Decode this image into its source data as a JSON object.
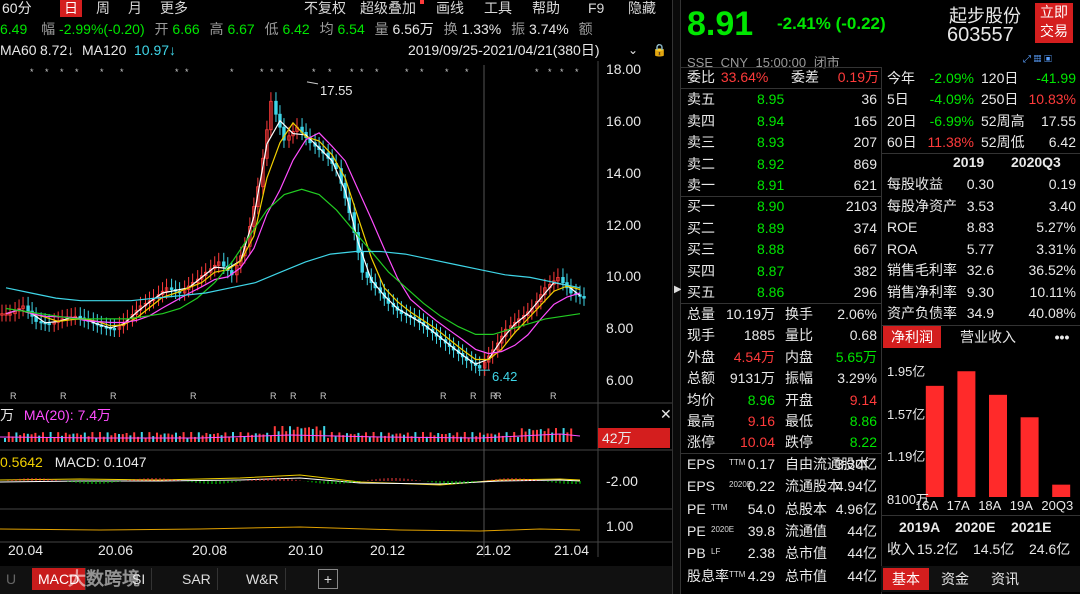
{
  "toolbar": {
    "period": "60分",
    "day": "日",
    "week": "周",
    "month": "月",
    "more": "更多",
    "fq": "不复权",
    "overlay": "超级叠加",
    "draw": "画线",
    "tools": "工具",
    "help": "帮助",
    "f9": "F9",
    "hide": "隐藏"
  },
  "quote_strip": {
    "price": "6.49",
    "change_label": "幅",
    "change": "-2.99%(-0.20)",
    "open_label": "开",
    "open": "6.66",
    "high_label": "高",
    "high": "6.67",
    "low_label": "低",
    "low": "6.42",
    "avg_label": "均",
    "avg": "6.54",
    "vol_label": "量",
    "vol": "6.56万",
    "turnover_label": "换",
    "turnover": "1.33%",
    "amp_label": "振",
    "amp": "3.74%",
    "amount_label": "额"
  },
  "ma_legend": {
    "ma60_label": "MA60",
    "ma60": "8.72↓",
    "ma120_label": "MA120",
    "ma120": "10.97↓",
    "range": "2019/09/25-2021/04/21(380日)"
  },
  "chart_data": {
    "type": "line",
    "title": "",
    "y_ticks": [
      "18.00",
      "16.00",
      "14.00",
      "12.00",
      "10.00",
      "8.00",
      "6.00"
    ],
    "ylim": [
      5.5,
      18.2
    ],
    "x_ticks": [
      "20.04",
      "20.06",
      "20.08",
      "20.10",
      "20.12",
      "21.02",
      "21.04"
    ],
    "high_label": "17.55",
    "low_label": "6.42",
    "price": [
      8.6,
      8.9,
      8.3,
      8.2,
      8.4,
      8.5,
      8.3,
      8.1,
      8.0,
      8.4,
      8.9,
      9.2,
      9.6,
      9.4,
      9.8,
      10.2,
      10.6,
      10.1,
      11.2,
      13.5,
      16.8,
      15.3,
      15.8,
      15.2,
      14.8,
      14.2,
      12.5,
      10.2,
      9.6,
      9.0,
      8.6,
      8.4,
      8.0,
      7.6,
      7.2,
      6.8,
      6.5,
      7.2,
      8.0,
      8.4,
      8.8,
      9.6,
      10.0,
      9.4,
      9.2
    ],
    "ma60": [
      8.8,
      8.7,
      8.6,
      8.5,
      8.4,
      8.4,
      8.4,
      8.4,
      8.5,
      8.6,
      8.8,
      9.2,
      9.8,
      10.6,
      11.6,
      12.6,
      13.2,
      13.4,
      13.2,
      12.6,
      11.8,
      11.0,
      10.2,
      9.6,
      9.0,
      8.5,
      8.1,
      7.8,
      7.8,
      8.0,
      8.2,
      8.4,
      8.5,
      8.6
    ],
    "ma120": [
      9.6,
      9.4,
      9.2,
      9.1,
      9.1,
      9.1,
      9.2,
      9.3,
      9.4,
      9.6,
      9.8,
      10.2,
      10.6,
      10.9,
      11.0,
      11.0,
      10.9,
      10.7,
      10.5,
      10.3,
      10.1,
      10.0,
      9.8,
      9.6
    ],
    "volume_legend": {
      "vol_label": "万",
      "ma20_label": "MA(20): 7.4万"
    },
    "volume_axis": "42万",
    "macd_legend": {
      "dif": "0.5642",
      "macd_label": "MACD: 0.1047"
    },
    "macd_axis": "-2.00",
    "lower_axis": "1.00"
  },
  "bottom_tabs": [
    "MACD",
    "SI",
    "SAR",
    "W&R",
    "+"
  ],
  "watermark": "大数跨境",
  "header": {
    "price": "8.91",
    "change": "-2.41% (-0.22)",
    "name": "起步股份",
    "code": "603557",
    "trade_btn_line1": "立即",
    "trade_btn_line2": "交易",
    "market": "SSE",
    "currency": "CNY",
    "time": "15:00:00",
    "status": "闭市"
  },
  "order_book": {
    "weibi_label": "委比",
    "weibi": "33.64%",
    "weicha_label": "委差",
    "weicha": "0.19万",
    "asks": [
      {
        "label": "卖五",
        "price": "8.95",
        "vol": "36"
      },
      {
        "label": "卖四",
        "price": "8.94",
        "vol": "165"
      },
      {
        "label": "卖三",
        "price": "8.93",
        "vol": "207"
      },
      {
        "label": "卖二",
        "price": "8.92",
        "vol": "869"
      },
      {
        "label": "卖一",
        "price": "8.91",
        "vol": "621"
      }
    ],
    "bids": [
      {
        "label": "买一",
        "price": "8.90",
        "vol": "2103"
      },
      {
        "label": "买二",
        "price": "8.89",
        "vol": "374"
      },
      {
        "label": "买三",
        "price": "8.88",
        "vol": "667"
      },
      {
        "label": "买四",
        "price": "8.87",
        "vol": "382"
      },
      {
        "label": "买五",
        "price": "8.86",
        "vol": "296"
      }
    ]
  },
  "stats": [
    {
      "l1": "总量",
      "v1": "10.19万",
      "l2": "换手",
      "v2": "2.06%"
    },
    {
      "l1": "现手",
      "v1": "1885",
      "l2": "量比",
      "v2": "0.68"
    },
    {
      "l1": "外盘",
      "v1": "4.54万",
      "l2": "内盘",
      "v2": "5.65万"
    },
    {
      "l1": "总额",
      "v1": "9131万",
      "l2": "振幅",
      "v2": "3.29%"
    },
    {
      "l1": "均价",
      "v1": "8.96",
      "l2": "开盘",
      "v2": "9.14"
    },
    {
      "l1": "最高",
      "v1": "9.16",
      "l2": "最低",
      "v2": "8.86"
    },
    {
      "l1": "涨停",
      "v1": "10.04",
      "l2": "跌停",
      "v2": "8.22"
    }
  ],
  "valuation": [
    {
      "l1": "EPS",
      "sup1": "TTM",
      "v1": "0.17",
      "l2": "自由流通股本",
      "v2": "3.30亿"
    },
    {
      "l1": "EPS",
      "sup1": "2020E",
      "v1": "0.22",
      "l2": "流通股本",
      "v2": "4.94亿"
    },
    {
      "l1": "PE",
      "sup1": "TTM",
      "v1": "54.0",
      "l2": "总股本",
      "v2": "4.96亿"
    },
    {
      "l1": "PE",
      "sup1": "2020E",
      "v1": "39.8",
      "l2": "流通值",
      "v2": "44亿"
    },
    {
      "l1": "PB",
      "sup1": "LF",
      "v1": "2.38",
      "l2": "总市值",
      "v2": "44亿"
    },
    {
      "l1": "股息率",
      "sup1": "TTM",
      "v1": "4.29",
      "l2": "总市值",
      "v2": "44亿"
    }
  ],
  "performance": {
    "rows": [
      {
        "l1": "今年",
        "v1": "-2.09%",
        "l2": "120日",
        "v2": "-41.99"
      },
      {
        "l1": "5日",
        "v1": "-4.09%",
        "l2": "250日",
        "v2": "10.83%"
      },
      {
        "l1": "20日",
        "v1": "-6.99%",
        "l2": "52周高",
        "v2": "17.55"
      },
      {
        "l1": "60日",
        "v1": "11.38%",
        "l2": "52周低",
        "v2": "6.42"
      }
    ],
    "col_2019": "2019",
    "col_2020q3": "2020Q3",
    "metrics": [
      {
        "label": "每股收益",
        "a": "0.30",
        "b": "0.19"
      },
      {
        "label": "每股净资产",
        "a": "3.53",
        "b": "3.40"
      },
      {
        "label": "ROE",
        "a": "8.83",
        "b": "5.27%"
      },
      {
        "label": "ROA",
        "a": "5.77",
        "b": "3.31%"
      },
      {
        "label": "销售毛利率",
        "a": "32.6",
        "b": "36.52%"
      },
      {
        "label": "销售净利率",
        "a": "9.30",
        "b": "10.11%"
      },
      {
        "label": "资产负债率",
        "a": "34.9",
        "b": "40.08%"
      }
    ]
  },
  "profit_chart": {
    "tab_active": "净利润",
    "tab_other": "营业收入",
    "more": "•••",
    "y_ticks": [
      "1.95亿",
      "1.57亿",
      "1.19亿",
      "8100万"
    ],
    "categories": [
      "16A",
      "17A",
      "18A",
      "19A",
      "20Q3"
    ],
    "values": [
      1.8,
      1.93,
      1.72,
      1.52,
      0.92
    ],
    "ylim": [
      0.81,
      1.95
    ],
    "forecast_labels": [
      "2019A",
      "2020E",
      "2021E"
    ],
    "income_label": "收入",
    "income_values": [
      "15.2亿",
      "14.5亿",
      "24.6亿"
    ]
  },
  "bottom_nav": [
    "基本",
    "资金",
    "资讯"
  ],
  "colors": {
    "up": "#ff3b3b",
    "down": "#00e600",
    "accent": "#d41e1e"
  }
}
